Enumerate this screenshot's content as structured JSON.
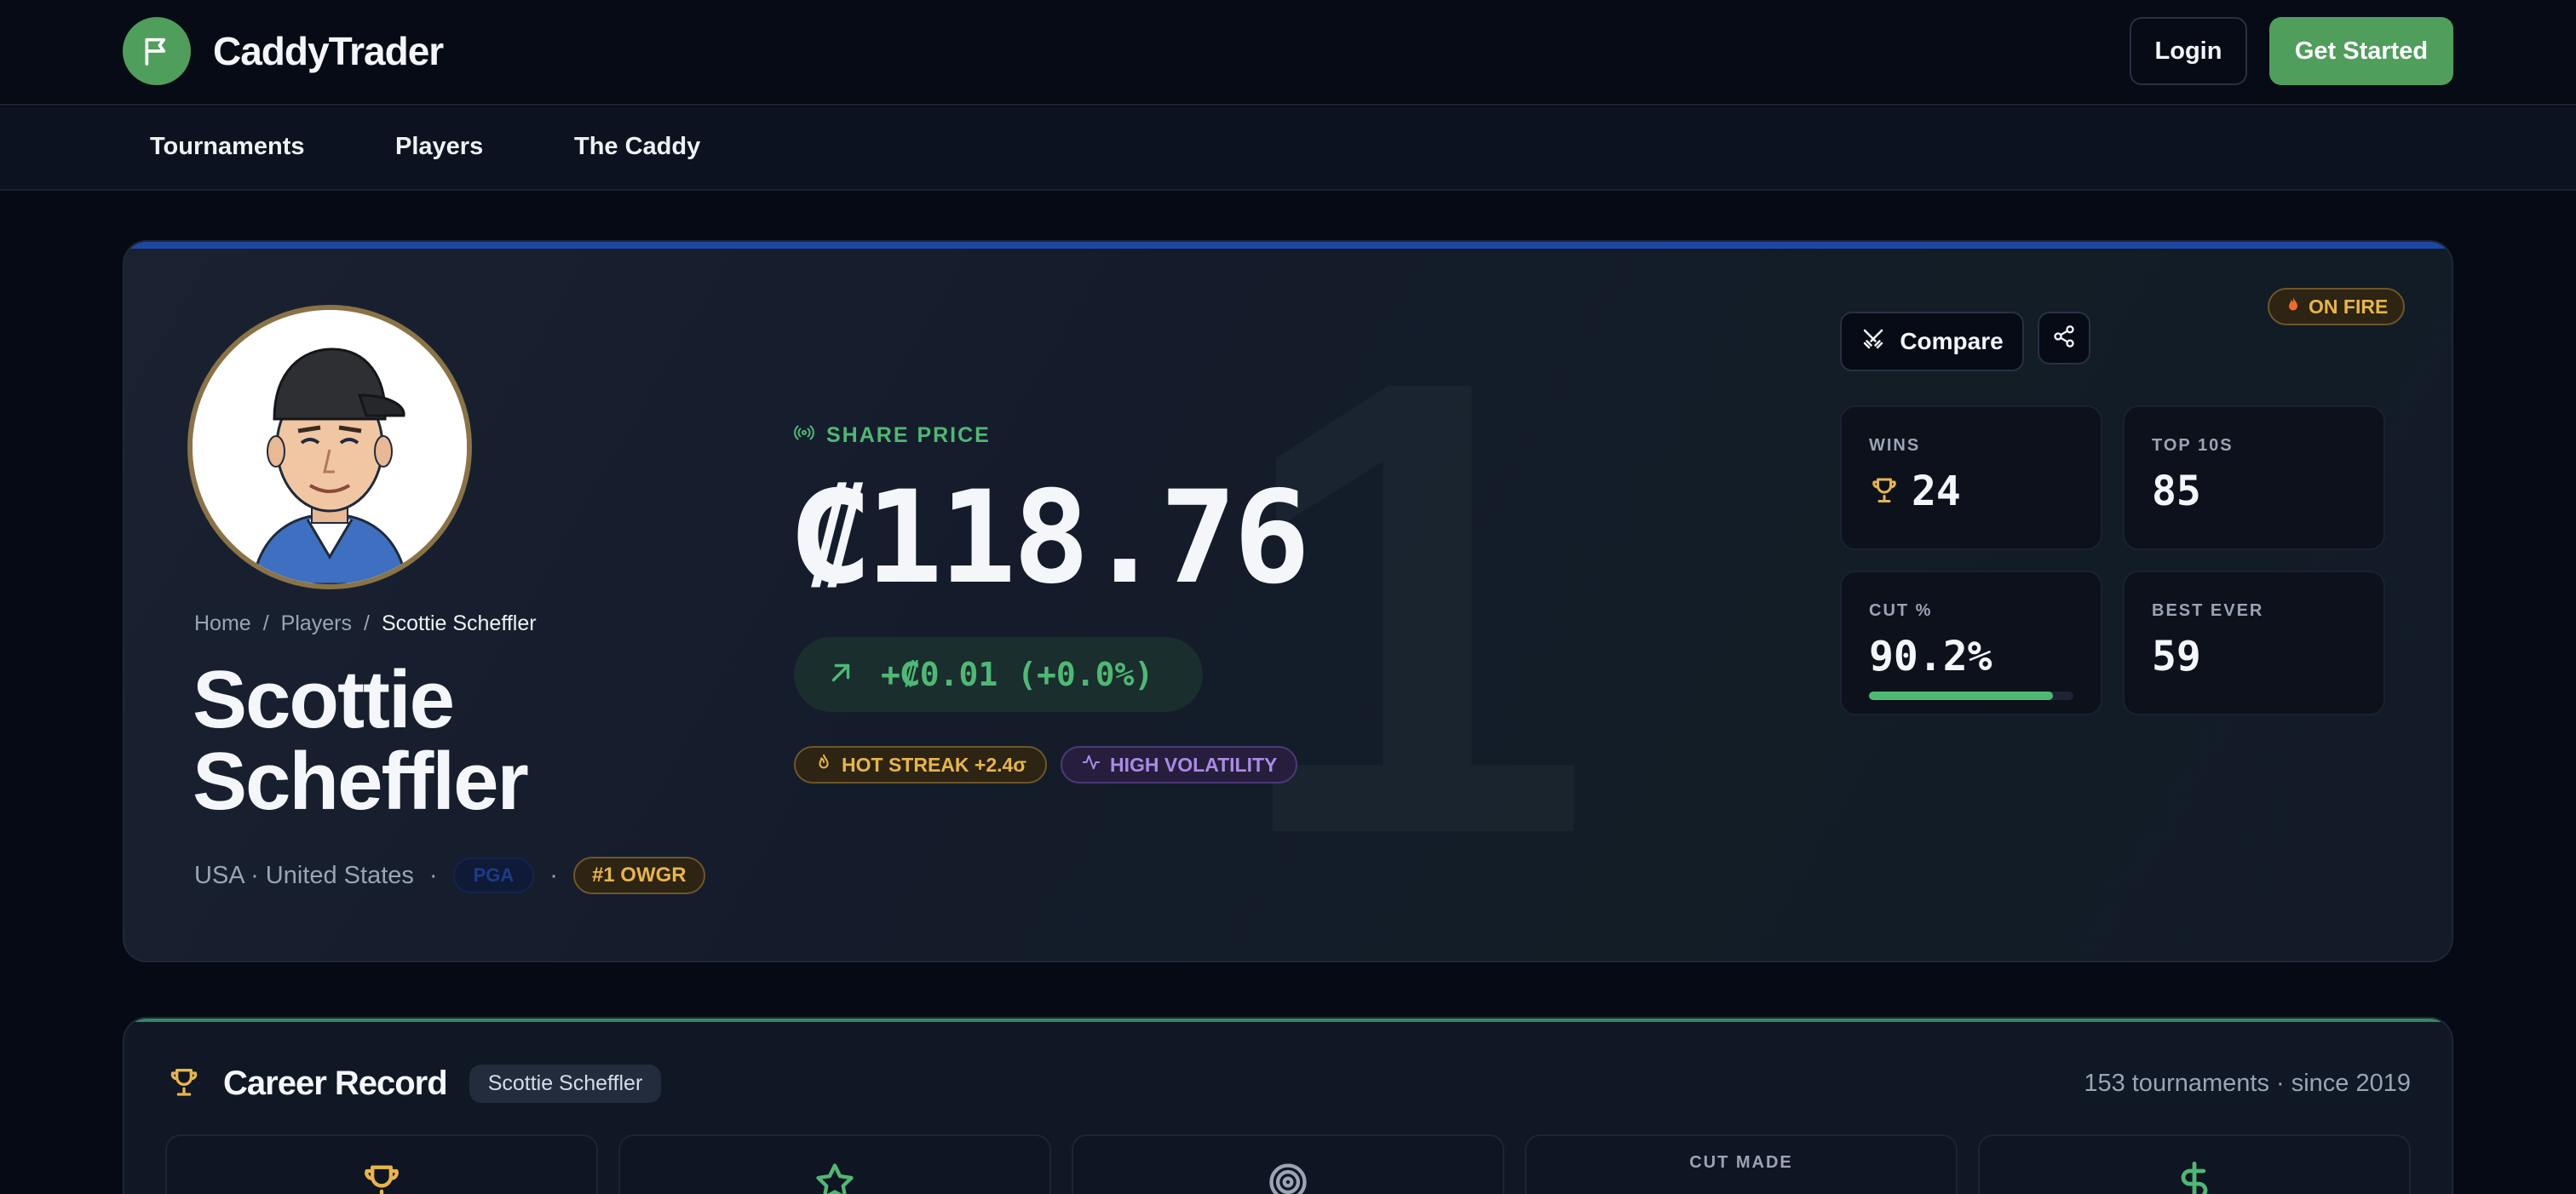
{
  "header": {
    "logo_text": "CaddyTrader",
    "login_label": "Login",
    "get_started_label": "Get Started"
  },
  "nav": {
    "items": [
      "Tournaments",
      "Players",
      "The Caddy"
    ]
  },
  "hero": {
    "breadcrumb": [
      "Home",
      "Players",
      "Scottie Scheffler"
    ],
    "player_name": "Scottie Scheffler",
    "country": "USA · United States",
    "separator": "·",
    "tour": "PGA",
    "owgr": "#1 OWGR",
    "background_rank": "1",
    "share_price_label": "SHARE PRICE",
    "price": "₡118.76",
    "change": "+₡0.01 (+0.0%)",
    "badges": {
      "hot_streak": "HOT STREAK +2.4σ",
      "volatility": "HIGH VOLATILITY"
    },
    "on_fire": "ON FIRE",
    "compare_label": "Compare",
    "stats": {
      "wins": {
        "label": "WINS",
        "value": "24"
      },
      "top10s": {
        "label": "TOP 10S",
        "value": "85"
      },
      "cut_pct": {
        "label": "CUT %",
        "value": "90.2%",
        "fraction": 0.902
      },
      "best_ever": {
        "label": "BEST EVER",
        "value": "59"
      }
    }
  },
  "career": {
    "title": "Career Record",
    "player_chip": "Scottie Scheffler",
    "summary": "153 tournaments · since 2019",
    "cards": [
      {
        "icon": "trophy-icon",
        "label": ""
      },
      {
        "icon": "star-icon",
        "label": ""
      },
      {
        "icon": "target-icon",
        "label": ""
      },
      {
        "icon": "",
        "label": "CUT MADE"
      },
      {
        "icon": "dollar-icon",
        "label": ""
      }
    ]
  },
  "colors": {
    "brand_green": "#4f9e5c",
    "price_up": "#4fb874",
    "gold": "#e8b54a",
    "purple": "#a98ae6",
    "hero_accent": "#1e47a4"
  }
}
